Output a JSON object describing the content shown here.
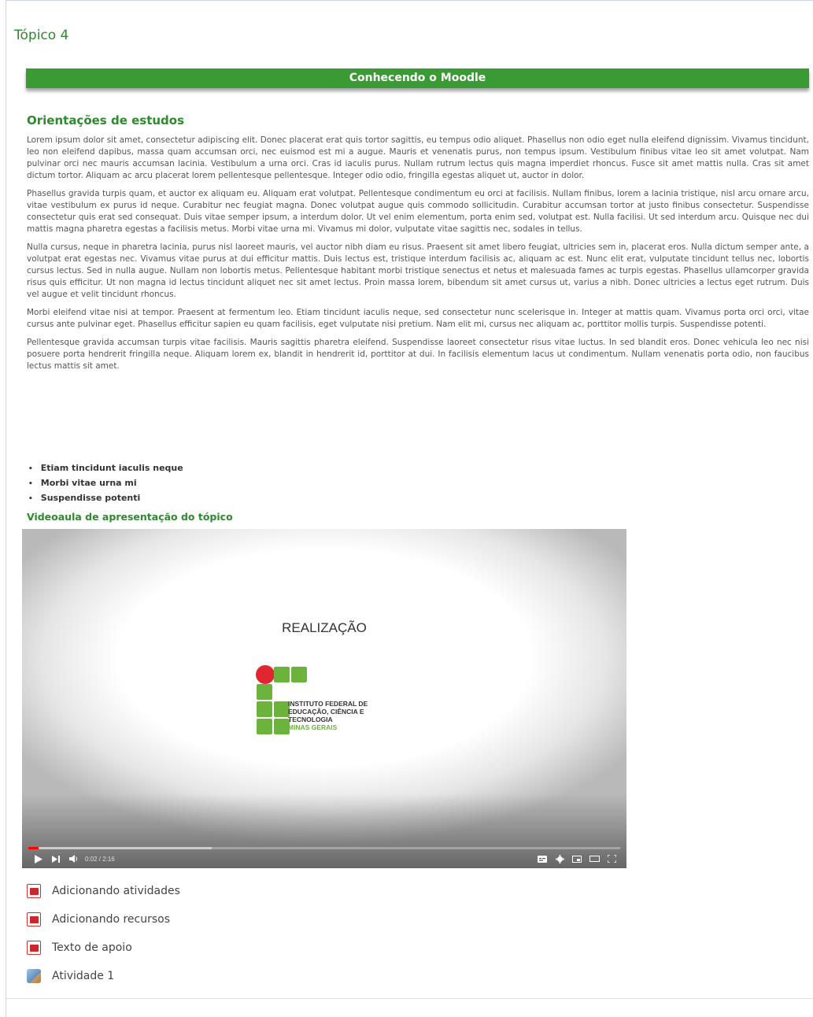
{
  "topic": {
    "title": "Tópico 4"
  },
  "banner": {
    "title": "Conhecendo o Moodle"
  },
  "study": {
    "title": "Orientações de estudos",
    "paragraphs": [
      "Lorem ipsum dolor sit amet, consectetur adipiscing elit. Donec placerat erat quis tortor sagittis, eu tempus odio aliquet. Phasellus non odio eget nulla eleifend dignissim. Vivamus tincidunt, leo non eleifend dapibus, massa quam accumsan orci, nec euismod est mi a augue. Mauris et venenatis purus, non tempus ipsum. Vestibulum finibus vitae leo sit amet volutpat. Nam pulvinar orci nec mauris accumsan lacinia. Vestibulum a urna orci. Cras id iaculis purus. Nullam rutrum lectus quis magna imperdiet rhoncus. Fusce sit amet mattis nulla. Cras sit amet dictum tortor. Aliquam ac arcu placerat lorem pellentesque pellentesque. Integer odio odio, fringilla egestas aliquet ut, auctor in dolor.",
      "Phasellus gravida turpis quam, et auctor ex aliquam eu. Aliquam erat volutpat. Pellentesque condimentum eu orci at facilisis. Nullam finibus, lorem a lacinia tristique, nisl arcu ornare arcu, vitae vestibulum ex purus id neque. Curabitur nec feugiat magna. Donec volutpat augue quis commodo sollicitudin. Curabitur accumsan tortor at justo finibus consectetur. Suspendisse consectetur quis erat sed consequat. Duis vitae semper ipsum, a interdum dolor. Ut vel enim elementum, porta enim sed, volutpat est. Nulla facilisi. Ut sed interdum arcu. Quisque nec dui mattis magna pharetra egestas a facilisis metus. Morbi vitae urna mi. Vivamus mi dolor, vulputate vitae sagittis nec, sodales in tellus.",
      "Nulla cursus, neque in pharetra lacinia, purus nisl laoreet mauris, vel auctor nibh diam eu risus. Praesent sit amet libero feugiat, ultricies sem in, placerat eros. Nulla dictum semper ante, a volutpat erat egestas nec. Vivamus vitae purus at dui efficitur mattis. Duis lectus est, tristique interdum facilisis ac, aliquam ac est. Nunc elit erat, vulputate tincidunt tellus nec, lobortis cursus lectus. Sed in nulla augue. Nullam non lobortis metus. Pellentesque habitant morbi tristique senectus et netus et malesuada fames ac turpis egestas. Phasellus ullamcorper gravida risus quis efficitur. Ut non magna id lectus tincidunt aliquet nec sit amet lectus. Proin massa lorem, bibendum sit amet cursus ut, varius a nibh. Donec ultricies a lectus eget rutrum. Duis vel augue et velit tincidunt rhoncus.",
      "Morbi eleifend vitae nisi at tempor. Praesent at fermentum leo. Etiam tincidunt iaculis neque, sed consectetur nunc scelerisque in. Integer at mattis quam. Vivamus porta orci orci, vitae cursus ante pulvinar eget. Phasellus efficitur sapien eu quam facilisis, eget vulputate nisi pretium. Nam elit mi, cursus nec aliquam ac, porttitor mollis turpis. Suspendisse potenti.",
      "Pellentesque gravida accumsan turpis vitae facilisis. Mauris sagittis pharetra eleifend. Suspendisse laoreet consectetur risus vitae luctus. In sed blandit eros. Donec vehicula leo nec nisi posuere porta hendrerit fringilla neque. Aliquam lorem ex, blandit in hendrerit id, porttitor at dui. In facilisis elementum lacus ut condimentum. Nullam venenatis porta odio, non faucibus lectus mattis sit amet."
    ],
    "bullets": [
      "Etiam tincidunt iaculis neque",
      "Morbi vitae urna mi",
      "Suspendisse potenti"
    ]
  },
  "video": {
    "heading": "Videoaula de apresentação do tópico",
    "slide_text": "REALIZAÇÃO",
    "logo_lines": [
      "INSTITUTO FEDERAL DE",
      "EDUCAÇÃO, CIÊNCIA E TECNOLOGIA",
      "MINAS GERAIS"
    ],
    "time": "0:02 / 2:16",
    "progress": 0.017,
    "buffered": 0.31,
    "icons": {
      "play": "play-icon",
      "next": "next-icon",
      "volume": "volume-icon",
      "subtitles": "subtitles-icon",
      "settings": "gear-icon",
      "miniplayer": "miniplayer-icon",
      "theater": "theater-icon",
      "fullscreen": "fullscreen-icon"
    }
  },
  "resources": [
    {
      "label": "Adicionando atividades",
      "icon": "pdf-icon"
    },
    {
      "label": "Adicionando recursos",
      "icon": "pdf-icon"
    },
    {
      "label": "Texto de apoio",
      "icon": "pdf-icon"
    },
    {
      "label": "Atividade 1",
      "icon": "assignment-icon"
    }
  ],
  "colors": {
    "accent_green": "#3a9a33",
    "title_green": "#2e8a2e",
    "logo_green": "#6cb33e",
    "logo_red": "#e2262f"
  }
}
